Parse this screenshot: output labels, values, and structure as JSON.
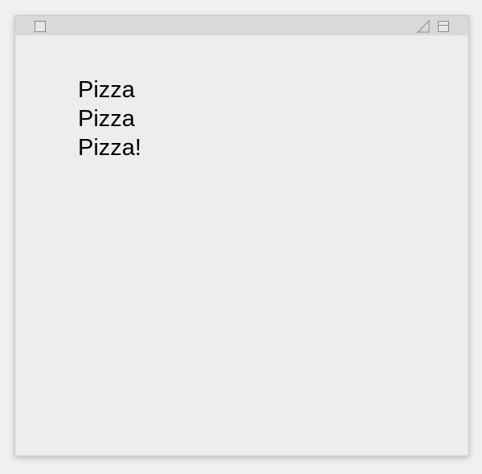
{
  "window": {
    "controls": {
      "close_icon": "square-icon",
      "resize_icon": "resize-corner-icon",
      "collapse_icon": "collapse-icon"
    },
    "note": {
      "lines": [
        "Pizza",
        "Pizza",
        "Pizza!"
      ]
    }
  },
  "colors": {
    "titlebar": "#d9d9d9",
    "window_background": "#ededed",
    "text": "#000000"
  }
}
